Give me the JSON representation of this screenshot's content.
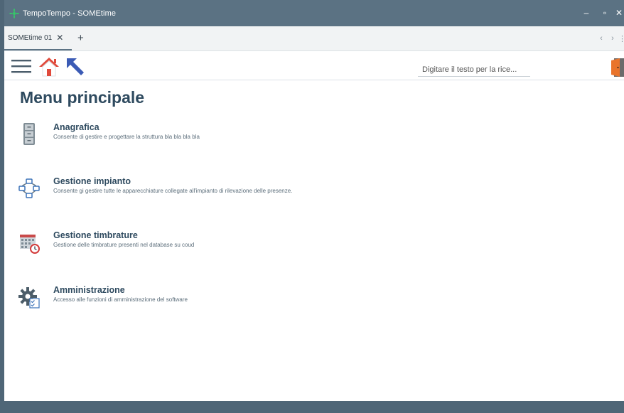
{
  "window": {
    "title": "TempoTempo - SOMEtime",
    "minimize_glyph": "–",
    "maximize_glyph": "▫",
    "close_glyph": "✕"
  },
  "tabs": [
    {
      "label": "SOMEtime 01",
      "close_glyph": "✕",
      "active": true
    }
  ],
  "tabbar": {
    "add_glyph": "+",
    "prev_glyph": "‹",
    "next_glyph": "›",
    "more_glyph": "⋮"
  },
  "toolbar": {
    "search_placeholder": "Digitare il testo per la rice...",
    "icons": [
      "hamburger-menu-icon",
      "home-icon",
      "back-arrow-icon",
      "exit-door-icon"
    ]
  },
  "main": {
    "title": "Menu principale",
    "items": [
      {
        "label": "Anagrafica",
        "description": "Consente di gestire e progettare la struttura bla bla bla bla",
        "icon": "filing-cabinet-icon"
      },
      {
        "label": "Gestione impianto",
        "description": "Consente gi gestire tutte le apparecchiature collegate all'impianto di rilevazione delle presenze.",
        "icon": "network-nodes-icon"
      },
      {
        "label": "Gestione timbrature",
        "description": "Gestione delle timbrature presenti nel database su coud",
        "icon": "calendar-clock-icon"
      },
      {
        "label": "Amministrazione",
        "description": "Accesso alle funzioni di amministrazione del software",
        "icon": "gear-checklist-icon"
      }
    ]
  },
  "colors": {
    "titlebar": "#5b7283",
    "footer": "#4f6677",
    "heading": "#2e4a5f",
    "accent_arrow": "#3b5bb5",
    "home_roof": "#e04a3c",
    "exit_door": "#e9742b"
  }
}
